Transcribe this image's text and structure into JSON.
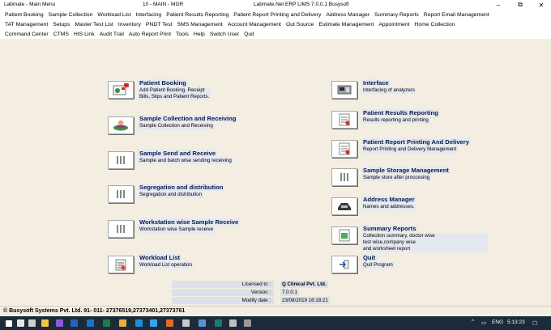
{
  "window": {
    "app_title": "Labmate - Main Menu",
    "mid_title": "10 - MAIN - MGR",
    "erp_title": "Labmate.Net ERP LIMS 7.0.0.1 Busysoft",
    "minimize": "–",
    "maximize": "⧉",
    "close": "✕"
  },
  "menu": {
    "row1": [
      "Patient Booking",
      "Sample Collection",
      "Workload List",
      "Interfacing",
      "Patient Results Reporting",
      "Patient Report Printing and Delivery",
      "Address Manager",
      "Summary Reports",
      "Report Email Management"
    ],
    "row2": [
      "TAT Management",
      "Setups",
      "Master Test List",
      "Inventory",
      "PNDT Test",
      "SMS Management",
      "Account Management",
      "Out Source",
      "Estimate Management",
      "Appointment",
      "Home Collection"
    ],
    "row3": [
      "Command Center",
      "CTMS",
      "HIS Link",
      "Audit Trail",
      "Auto Report Print",
      "Tools",
      "Help",
      "Switch User",
      "Quit"
    ]
  },
  "tiles": {
    "patient_booking": {
      "title": "Patient Booking",
      "desc": [
        "Add Patient Booking, Receipt",
        "Bills, Slips and Patient Reports."
      ],
      "icon": "booking-icon"
    },
    "sample_collection": {
      "title": "Sample Collection and Receiving",
      "desc": [
        "Sample Collection and Receiving"
      ],
      "icon": "collection-icon"
    },
    "sample_send": {
      "title": "Sample Send and  Receive",
      "desc": [
        "Sample  and batch wise sending receiving"
      ],
      "icon": "tube-rack-icon"
    },
    "segregation": {
      "title": "Segregation and distribution",
      "desc": [
        "Segregation and distribution"
      ],
      "icon": "tube-rack-icon"
    },
    "workstation": {
      "title": "Workstation wise Sample Receive",
      "desc": [
        "Workstation wise Sample receive"
      ],
      "icon": "tube-rack-icon"
    },
    "workload": {
      "title": "Workload List",
      "desc": [
        "Workload List operation"
      ],
      "icon": "clipboard-icon"
    },
    "interface": {
      "title": "Interface",
      "desc": [
        "Interfacing of analyzers"
      ],
      "icon": "analyzer-icon"
    },
    "results": {
      "title": "Patient Results Reporting",
      "desc": [
        "Results reporting and printing"
      ],
      "icon": "report-icon"
    },
    "printing": {
      "title": "Patient Report Printing And Delivery",
      "desc": [
        "Report Printing and Delivery Management"
      ],
      "icon": "report-icon"
    },
    "storage": {
      "title": "Sample Storage Management",
      "desc": [
        "Sample store after proccesing"
      ],
      "icon": "tube-rack-icon"
    },
    "address": {
      "title": "Address Manager",
      "desc": [
        "Names and addresses."
      ],
      "icon": "phone-icon"
    },
    "summary": {
      "title": "Summary Reports",
      "desc": [
        "Collection summary, doctor wise",
        "test wise,company wise",
        "and worksheet report"
      ],
      "icon": "summary-icon"
    },
    "quit": {
      "title": "Quit",
      "desc": [
        "Quit Program"
      ],
      "icon": "exit-icon"
    }
  },
  "license": {
    "licensed_label": "Licensed to :",
    "licensed_value": "Q Clinical Pvt. Ltd.",
    "version_label": "Version :",
    "version_value": "7.0.0.1",
    "modify_label": "Modify date :",
    "modify_value": "23/08/2019 16:18:21"
  },
  "footer": {
    "copyright": "© Busysoft Systems Pvt. Ltd.  91- 011- 27376519,27373401,27373761"
  },
  "taskbar": {
    "lang": "ENG",
    "time": "5:13:23",
    "chevron": "^",
    "apps": [
      {
        "name": "start-icon",
        "color": "#ffffff"
      },
      {
        "name": "search-icon",
        "color": "#e6e6e6"
      },
      {
        "name": "task-view-icon",
        "color": "#d0d0d0"
      },
      {
        "name": "explorer-icon",
        "color": "#f4c542"
      },
      {
        "name": "visual-studio-icon",
        "color": "#8a5bd6"
      },
      {
        "name": "word-icon",
        "color": "#2b5fb8"
      },
      {
        "name": "outlook-icon",
        "color": "#1c73c9"
      },
      {
        "name": "excel-icon",
        "color": "#1f7a46"
      },
      {
        "name": "chrome-icon",
        "color": "#e8b23a"
      },
      {
        "name": "edge-icon",
        "color": "#1e8fd6"
      },
      {
        "name": "ie-icon",
        "color": "#3aa1e6"
      },
      {
        "name": "firefox-icon",
        "color": "#e86a2a"
      },
      {
        "name": "app-icon",
        "color": "#c8c8c8"
      },
      {
        "name": "app-icon-2",
        "color": "#5b8fd8"
      },
      {
        "name": "publisher-icon",
        "color": "#1e7a6e"
      },
      {
        "name": "labmate-icon",
        "color": "#bfbfbf"
      },
      {
        "name": "app-icon-3",
        "color": "#9a9a9a"
      }
    ]
  }
}
